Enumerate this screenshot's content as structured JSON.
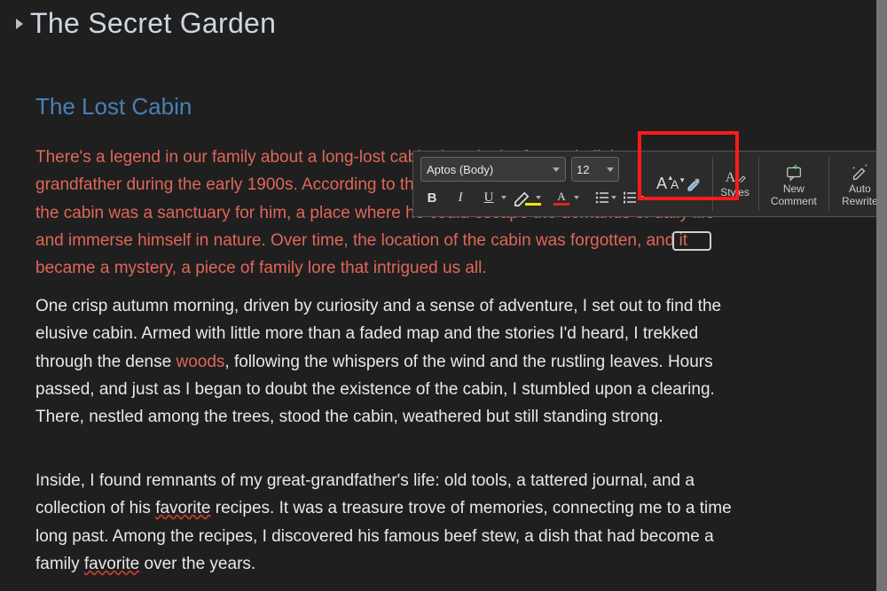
{
  "document": {
    "title": "The Secret Garden",
    "subtitle": "The Lost Cabin",
    "p1_text": "There's a legend in our family about a long-lost cabin deep in the forest, built by my great-grandfather during the early 1900s. According to the stories passed down through generations, the cabin was a sanctuary for him, a place where he could escape the demands of daily life and immerse himself in nature. Over time, the location of the cabin was forgotten, and it became a mystery, a piece of family lore that intrigued us all.",
    "p2_a": "One crisp autumn morning, driven by curiosity and a sense of adventure, I set out to find the elusive cabin. Armed with little more than a faded map and the stories I'd heard, I trekked through the dense ",
    "p2_link": "woods",
    "p2_b": ", following the whispers of the wind and the rustling leaves. Hours passed, and just as I began to doubt the existence of the cabin, I stumbled upon a clearing. There, nestled among the trees, stood the cabin, weathered but still standing strong.",
    "p3_a": "Inside, I found remnants of my great-grandfather's life: old tools, a tattered journal, and a collection of his ",
    "p3_fav1": "favorite",
    "p3_b": " recipes. It was a treasure trove of memories, connecting me to a time long past. Among the recipes, I discovered his famous beef stew, a dish that had become a family ",
    "p3_fav2": "favorite",
    "p3_c": " over the years."
  },
  "toolbar": {
    "font_name": "Aptos (Body)",
    "font_size": "12",
    "bold": "B",
    "italic": "I",
    "underline": "U",
    "font_color_letter": "A",
    "grow_letter": "A",
    "shrink_letter": "A",
    "styles_label": "Styles",
    "new_comment_label": "New Comment",
    "auto_rewrite_label": "Auto Rewrite",
    "styles_icon_top": "A"
  },
  "colors": {
    "heading": "#cfd6e2",
    "subtitle": "#4a7fb8",
    "accent_text": "#e06659",
    "body_text": "#e8e8e8",
    "highlight_annotation": "#ff1a1a"
  }
}
